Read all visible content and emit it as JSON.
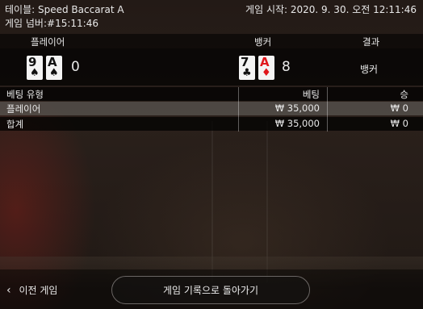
{
  "header": {
    "table": "테이블: Speed Baccarat A",
    "game_number": "게임 넘버:#15:11:46",
    "start_time": "게임 시작: 2020. 9. 30. 오전 12:11:46"
  },
  "result": {
    "col_player": "플레이어",
    "col_banker": "뱅커",
    "col_result": "결과",
    "player_cards": [
      {
        "rank": "9",
        "suit": "♠"
      },
      {
        "rank": "A",
        "suit": "♠"
      }
    ],
    "player_score": "0",
    "banker_cards": [
      {
        "rank": "7",
        "suit": "♣"
      },
      {
        "rank": "A",
        "suit": "♦"
      }
    ],
    "banker_score": "8",
    "outcome": "뱅커"
  },
  "bets": {
    "col_type": "베팅 유형",
    "col_bet": "베팅",
    "col_win": "승",
    "rows": [
      {
        "type": "플레이어",
        "bet": "₩ 35,000",
        "win": "₩ 0"
      },
      {
        "type": "합계",
        "bet": "₩ 35,000",
        "win": "₩ 0"
      }
    ]
  },
  "footer": {
    "prev_label": "이전 게임",
    "back_label": "게임 기록으로 돌아가기"
  },
  "colors": {
    "red_suit": "#e0161b",
    "accent_bg": "#1b1512"
  }
}
